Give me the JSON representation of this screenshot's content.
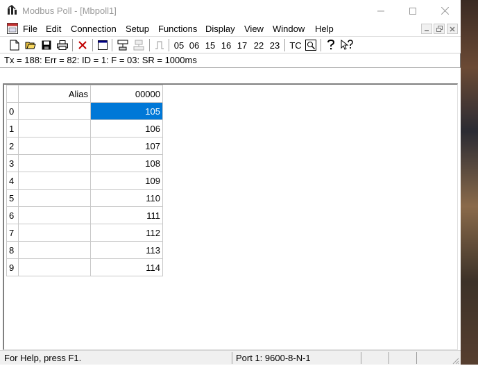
{
  "window": {
    "title": "Modbus Poll - [Mbpoll1]"
  },
  "menu": {
    "items": [
      "File",
      "Edit",
      "Connection",
      "Setup",
      "Functions",
      "Display",
      "View",
      "Window",
      "Help"
    ]
  },
  "toolbar": {
    "function_codes": [
      "05",
      "06",
      "15",
      "16",
      "17",
      "22",
      "23"
    ],
    "tc_label": "TC"
  },
  "comm_status": "Tx = 188: Err = 82: ID = 1: F = 03: SR = 1000ms",
  "grid": {
    "alias_header": "Alias",
    "address_header": "00000",
    "rows": [
      {
        "index": "0",
        "alias": "",
        "value": "105"
      },
      {
        "index": "1",
        "alias": "",
        "value": "106"
      },
      {
        "index": "2",
        "alias": "",
        "value": "107"
      },
      {
        "index": "3",
        "alias": "",
        "value": "108"
      },
      {
        "index": "4",
        "alias": "",
        "value": "109"
      },
      {
        "index": "5",
        "alias": "",
        "value": "110"
      },
      {
        "index": "6",
        "alias": "",
        "value": "111"
      },
      {
        "index": "7",
        "alias": "",
        "value": "112"
      },
      {
        "index": "8",
        "alias": "",
        "value": "113"
      },
      {
        "index": "9",
        "alias": "",
        "value": "114"
      }
    ],
    "selected_row": 0
  },
  "statusbar": {
    "help_text": "For Help, press F1.",
    "port_text": "Port 1: 9600-8-N-1"
  },
  "colors": {
    "selection": "#0078d7",
    "title_text": "#999999"
  }
}
